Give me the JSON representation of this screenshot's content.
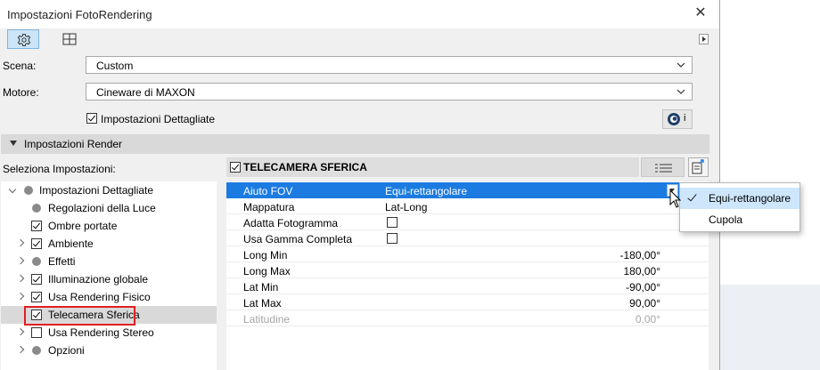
{
  "window": {
    "title": "Impostazioni FotoRendering",
    "close_glyph": "✕"
  },
  "toolbar": {
    "items": [
      {
        "name": "settings-gear-icon",
        "active": true
      },
      {
        "name": "grid-view-icon",
        "active": false
      }
    ],
    "overflow_icon": "scroll-right-icon"
  },
  "form": {
    "scene_label": "Scena:",
    "scene_value": "Custom",
    "engine_label": "Motore:",
    "engine_value": "Cineware di MAXON",
    "detailed_label": "Impostazioni Dettagliate",
    "detailed_checked": true,
    "engine_info_icon": "cinema4d-info-icon",
    "engine_info_text": "i"
  },
  "section": {
    "label": "Impostazioni Render"
  },
  "settings": {
    "select_label": "Seleziona Impostazioni:",
    "current_title": "TELECAMERA SFERICA",
    "current_checked": true
  },
  "tree": {
    "items": [
      {
        "label": "Impostazioni Dettagliate",
        "marker": "dot",
        "expander": "open",
        "level": 0
      },
      {
        "label": "Regolazioni della Luce",
        "marker": "dot",
        "expander": "none",
        "level": 1
      },
      {
        "label": "Ombre portate",
        "marker": "checked",
        "expander": "none",
        "level": 1
      },
      {
        "label": "Ambiente",
        "marker": "checked",
        "expander": "closed",
        "level": 1
      },
      {
        "label": "Effetti",
        "marker": "dot",
        "expander": "closed",
        "level": 1
      },
      {
        "label": "Illuminazione globale",
        "marker": "checked",
        "expander": "closed",
        "level": 1
      },
      {
        "label": "Usa Rendering Fisico",
        "marker": "checked",
        "expander": "closed",
        "level": 1
      },
      {
        "label": "Telecamera Sferica",
        "marker": "checked",
        "expander": "none",
        "level": 1,
        "selected": true
      },
      {
        "label": "Usa Rendering Stereo",
        "marker": "unchecked",
        "expander": "closed",
        "level": 1
      },
      {
        "label": "Opzioni",
        "marker": "dot",
        "expander": "closed",
        "level": 1
      }
    ]
  },
  "properties": {
    "rows": [
      {
        "key": "Aiuto FOV",
        "value": "Equi-rettangolare",
        "kind": "dropdown",
        "selected": true
      },
      {
        "key": "Mappatura",
        "value": "Lat-Long",
        "kind": "text"
      },
      {
        "key": "Adatta Fotogramma",
        "value": "",
        "kind": "checkbox",
        "checked": false
      },
      {
        "key": "Usa Gamma Completa",
        "value": "",
        "kind": "checkbox",
        "checked": false
      },
      {
        "key": "Long Min",
        "value": "-180,00°",
        "kind": "number"
      },
      {
        "key": "Long Max",
        "value": "180,00°",
        "kind": "number"
      },
      {
        "key": "Lat Min",
        "value": "-90,00°",
        "kind": "number"
      },
      {
        "key": "Lat Max",
        "value": "90,00°",
        "kind": "number"
      },
      {
        "key": "Latitudine",
        "value": "0,00°",
        "kind": "number",
        "disabled": true
      }
    ]
  },
  "dropdown_popup": {
    "options": [
      {
        "label": "Equi-rettangolare",
        "checked": true
      },
      {
        "label": "Cupola",
        "checked": false
      }
    ]
  },
  "colors": {
    "selection_blue": "#1c7be0",
    "toolbar_active": "#cce4f7",
    "highlight_red": "#e02020"
  }
}
